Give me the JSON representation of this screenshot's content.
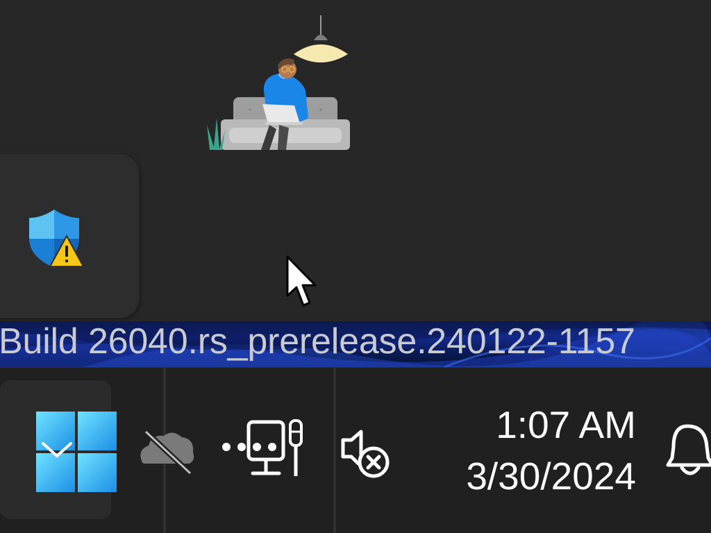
{
  "desktop": {
    "illustration_icon": "person-on-couch-illustration",
    "security_icon": "windows-security-warning-icon",
    "cursor_icon": "mouse-pointer-icon"
  },
  "watermark": {
    "build_text": "Build 26040.rs_prerelease.240122-1157"
  },
  "taskbar": {
    "start_icon": "windows-start-icon",
    "tray_icons": [
      "onedrive-offline-icon",
      "network-disconnected-icon",
      "volume-muted-icon"
    ],
    "clock": {
      "time": "1:07 AM",
      "date": "3/30/2024"
    },
    "notifications_icon": "bell-icon"
  },
  "colors": {
    "desktop_bg": "#272727",
    "taskbar_bg": "#202020",
    "accent_blue": "#1a8cff",
    "warning_yellow": "#f5c518"
  }
}
